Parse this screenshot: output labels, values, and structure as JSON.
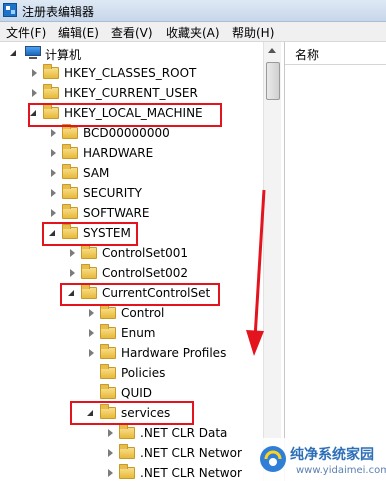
{
  "window": {
    "title": "注册表编辑器",
    "icon": "registry-editor-icon"
  },
  "menu": [
    "文件(F)",
    "编辑(E)",
    "查看(V)",
    "收藏夹(A)",
    "帮助(H)"
  ],
  "right_pane": {
    "column_header": "名称"
  },
  "tree": {
    "root": "计算机",
    "hklm_children": [
      "BCD00000000",
      "HARDWARE",
      "SAM",
      "SECURITY",
      "SOFTWARE"
    ],
    "roots": {
      "classes_root": "HKEY_CLASSES_ROOT",
      "current_user": "HKEY_CURRENT_USER",
      "local_machine": "HKEY_LOCAL_MACHINE"
    },
    "system": "SYSTEM",
    "control_sets": [
      "ControlSet001",
      "ControlSet002"
    ],
    "current_control_set": "CurrentControlSet",
    "ccs_children": [
      "Control",
      "Enum",
      "Hardware Profiles",
      "Policies",
      "QUID"
    ],
    "services": "services",
    "services_children": [
      ".NET CLR Data",
      ".NET CLR Networ",
      ".NET CLR Networ"
    ]
  },
  "annotation": {
    "highlight_color": "#e3141e",
    "arrow": "down-arrow"
  },
  "watermark": {
    "title": "纯净系统家园",
    "url": "www.yidaimei.com"
  }
}
